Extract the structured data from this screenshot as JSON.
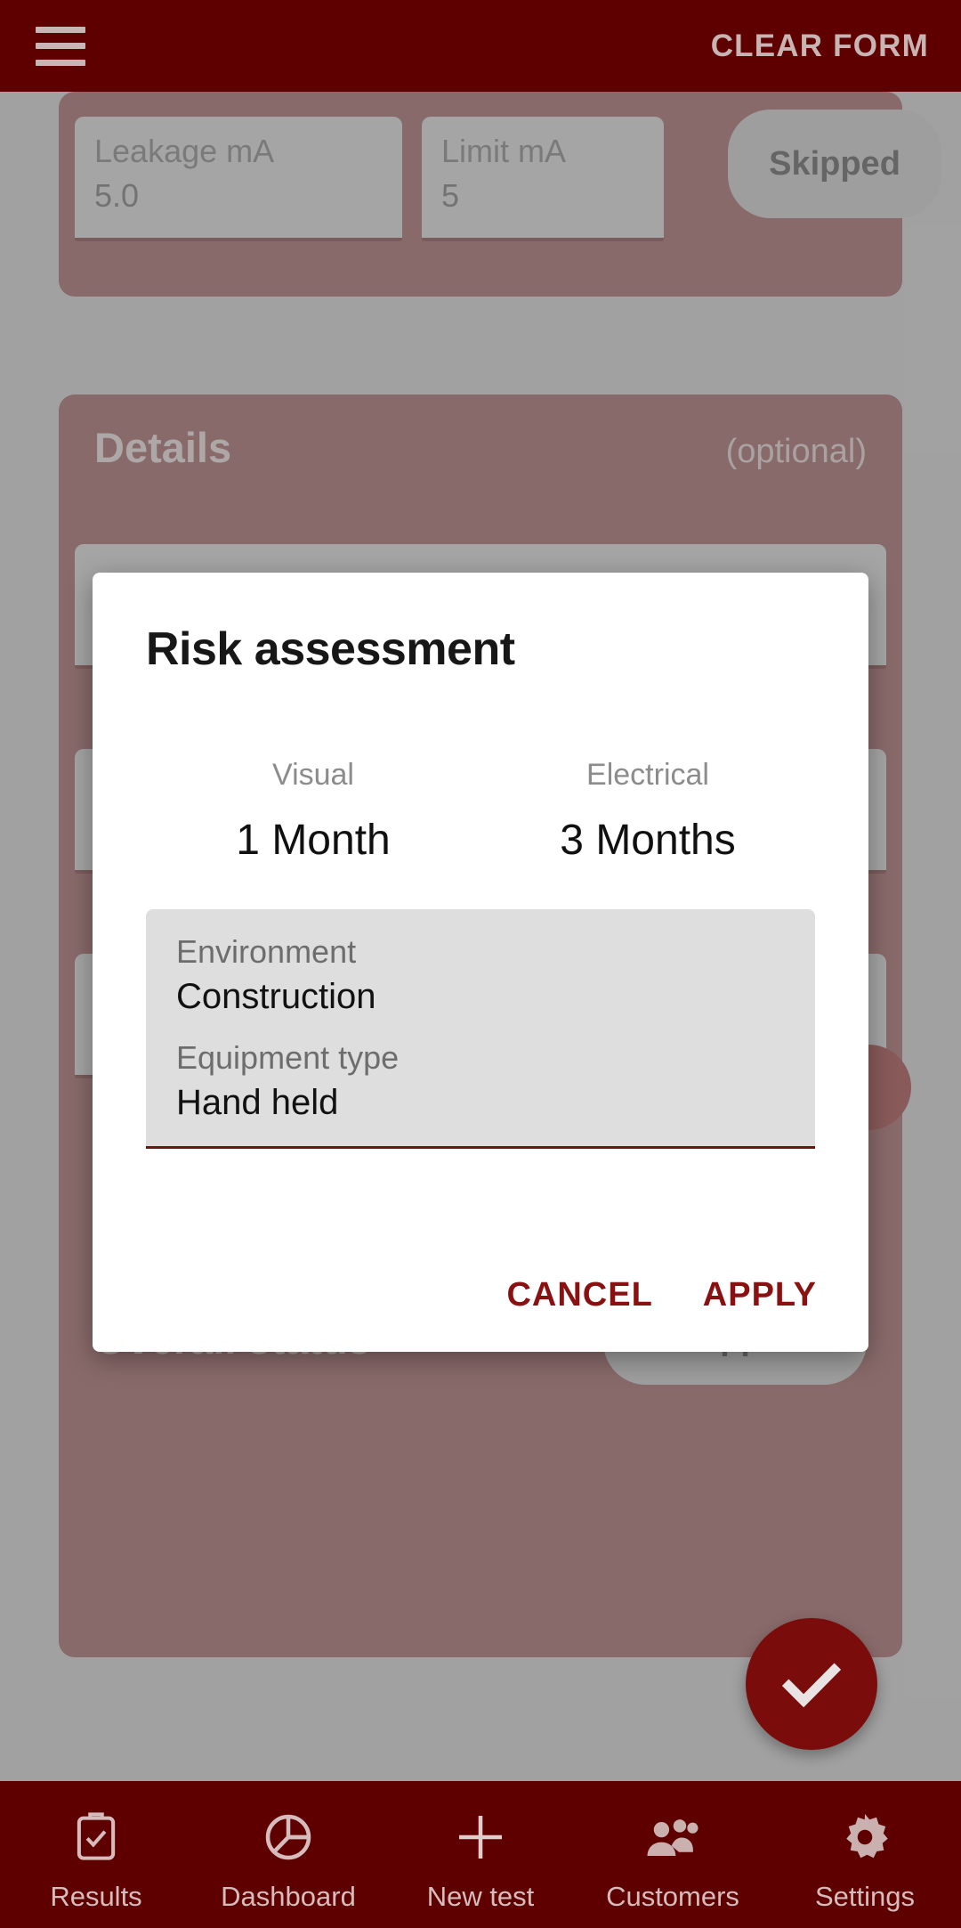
{
  "appbar": {
    "menu_icon": "hamburger-menu-icon",
    "clear_form_label": "CLEAR FORM"
  },
  "form": {
    "leakage_field": {
      "label": "Leakage mA",
      "value": "5.0"
    },
    "limit_field": {
      "label": "Limit mA",
      "value": "5"
    },
    "top_status_chip": "Skipped",
    "details_card": {
      "title": "Details",
      "optional_label": "(optional)"
    },
    "overall_status": {
      "label": "Overall status",
      "value": "Skipped"
    }
  },
  "dialog": {
    "title": "Risk assessment",
    "periods": [
      {
        "caption": "Visual",
        "value": "1 Month"
      },
      {
        "caption": "Electrical",
        "value": "3 Months"
      }
    ],
    "selects": [
      {
        "label": "Environment",
        "value": "Construction"
      },
      {
        "label": "Equipment type",
        "value": "Hand held"
      }
    ],
    "cancel_label": "CANCEL",
    "apply_label": "APPLY"
  },
  "fab": {
    "icon": "check-icon"
  },
  "bottom_nav": {
    "items": [
      {
        "label": "Results",
        "icon": "clipboard-check-icon"
      },
      {
        "label": "Dashboard",
        "icon": "pie-chart-icon"
      },
      {
        "label": "New test",
        "icon": "plus-icon"
      },
      {
        "label": "Customers",
        "icon": "people-icon"
      },
      {
        "label": "Settings",
        "icon": "gear-icon"
      }
    ]
  },
  "colors": {
    "app_bar": "#5e0000",
    "card": "#7a3536",
    "accent": "#8a1111",
    "page_background": "#b0b0b0"
  }
}
